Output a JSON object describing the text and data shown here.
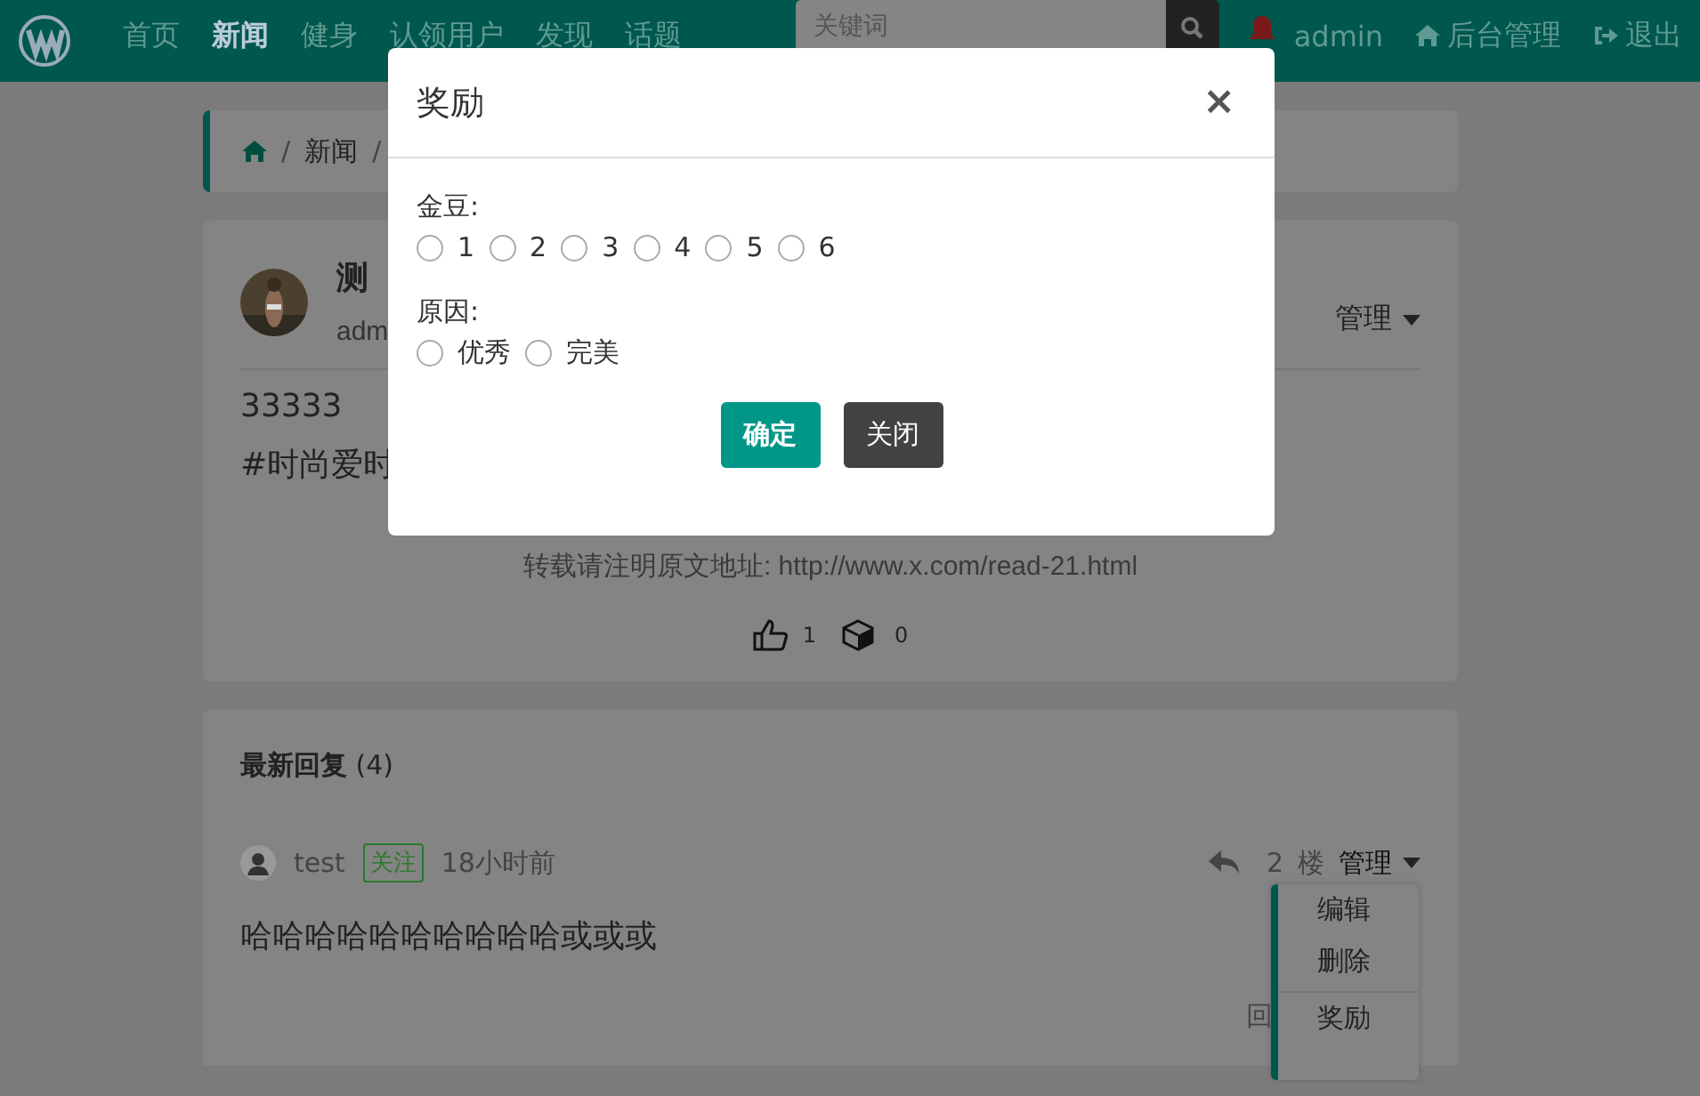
{
  "navbar": {
    "nav_items": [
      {
        "label": "首页",
        "selected": false
      },
      {
        "label": "新闻",
        "selected": true
      },
      {
        "label": "健身",
        "selected": false
      },
      {
        "label": "认领用户",
        "selected": false
      },
      {
        "label": "发现",
        "selected": false
      },
      {
        "label": "话题",
        "selected": false
      }
    ],
    "search": {
      "placeholder": "关键词"
    },
    "user": "admin",
    "links": [
      {
        "label": "后台管理"
      },
      {
        "label": "退出"
      }
    ]
  },
  "breadcrumb": [
    {
      "kind": "separator",
      "text": "/"
    },
    {
      "kind": "link",
      "text": "新闻"
    },
    {
      "kind": "separator",
      "text": "/"
    }
  ],
  "post": {
    "author_name": "测",
    "author_meta": "adm",
    "manage": "管理",
    "body": [
      "33333",
      "#时尚爱时"
    ],
    "source": "转载请注明原文地址: http://www.x.com/read-21.html",
    "likes": "1",
    "favorites": "0"
  },
  "replies": {
    "title": "最新回复",
    "count": "(4)",
    "items": [
      {
        "user": "test",
        "follow": "关注",
        "time": "18小时前",
        "floor": "2",
        "floor_unit": "楼",
        "manage": "管理",
        "text": "哈哈哈哈哈哈哈哈哈哈或或或",
        "action": "回"
      }
    ],
    "menu": [
      {
        "label": "编辑"
      },
      {
        "label": "删除"
      },
      {
        "label": "奖励"
      }
    ]
  },
  "modal": {
    "title": "奖励",
    "close": "×",
    "groups": [
      {
        "label": "金豆:",
        "options": [
          {
            "label": "1",
            "selected": false
          },
          {
            "label": "2",
            "selected": false
          },
          {
            "label": "3",
            "selected": false
          },
          {
            "label": "4",
            "selected": false
          },
          {
            "label": "5",
            "selected": false
          },
          {
            "label": "6",
            "selected": false
          }
        ]
      },
      {
        "label": "原因:",
        "options": [
          {
            "label": "优秀",
            "selected": false
          },
          {
            "label": "完美",
            "selected": false
          }
        ]
      }
    ],
    "buttons": [
      {
        "label": "确定",
        "kind": "primary"
      },
      {
        "label": "关闭",
        "kind": "secondary"
      }
    ]
  }
}
